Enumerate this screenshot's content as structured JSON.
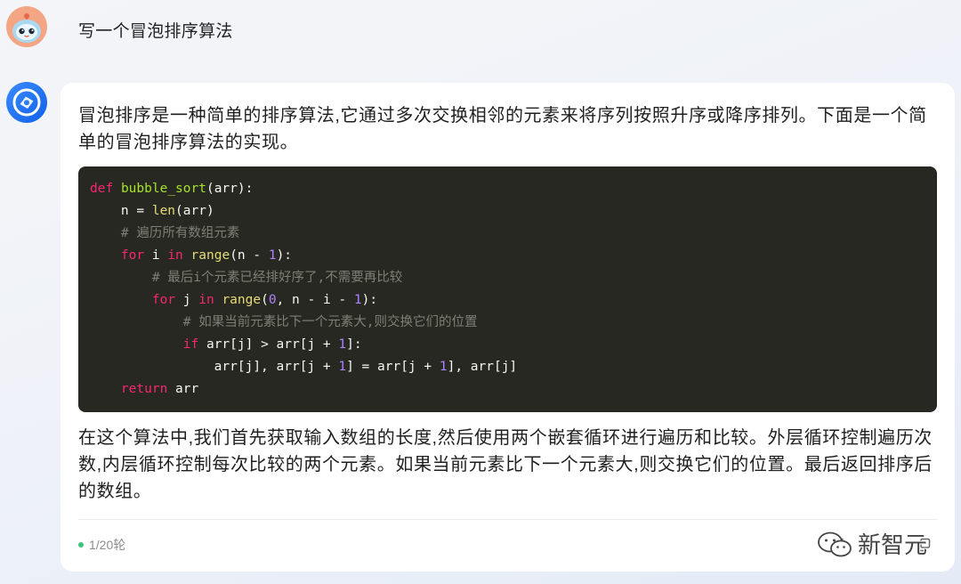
{
  "user": {
    "avatar_icon": "user-mascot-avatar",
    "message": "写一个冒泡排序算法"
  },
  "assistant": {
    "avatar_icon": "assistant-logo-avatar",
    "intro": "冒泡排序是一种简单的排序算法,它通过多次交换相邻的元素来将序列按照升序或降序排列。下面是一个简单的冒泡排序算法的实现。",
    "code": {
      "lines": [
        [
          {
            "type": "keyword",
            "text": "def"
          },
          {
            "type": "plain",
            "text": " "
          },
          {
            "type": "function",
            "text": "bubble_sort"
          },
          {
            "type": "plain",
            "text": "(arr):"
          }
        ],
        [
          {
            "type": "plain",
            "text": "    n = "
          },
          {
            "type": "builtin",
            "text": "len"
          },
          {
            "type": "plain",
            "text": "(arr)"
          }
        ],
        [
          {
            "type": "plain",
            "text": "    "
          },
          {
            "type": "comment",
            "text": "# 遍历所有数组元素"
          }
        ],
        [
          {
            "type": "plain",
            "text": "    "
          },
          {
            "type": "keyword",
            "text": "for"
          },
          {
            "type": "plain",
            "text": " i "
          },
          {
            "type": "keyword",
            "text": "in"
          },
          {
            "type": "plain",
            "text": " "
          },
          {
            "type": "builtin",
            "text": "range"
          },
          {
            "type": "plain",
            "text": "(n - "
          },
          {
            "type": "number",
            "text": "1"
          },
          {
            "type": "plain",
            "text": "):"
          }
        ],
        [
          {
            "type": "plain",
            "text": "        "
          },
          {
            "type": "comment",
            "text": "# 最后i个元素已经排好序了,不需要再比较"
          }
        ],
        [
          {
            "type": "plain",
            "text": "        "
          },
          {
            "type": "keyword",
            "text": "for"
          },
          {
            "type": "plain",
            "text": " j "
          },
          {
            "type": "keyword",
            "text": "in"
          },
          {
            "type": "plain",
            "text": " "
          },
          {
            "type": "builtin",
            "text": "range"
          },
          {
            "type": "plain",
            "text": "("
          },
          {
            "type": "number",
            "text": "0"
          },
          {
            "type": "plain",
            "text": ", n - i - "
          },
          {
            "type": "number",
            "text": "1"
          },
          {
            "type": "plain",
            "text": "):"
          }
        ],
        [
          {
            "type": "plain",
            "text": "            "
          },
          {
            "type": "comment",
            "text": "# 如果当前元素比下一个元素大,则交换它们的位置"
          }
        ],
        [
          {
            "type": "plain",
            "text": "            "
          },
          {
            "type": "keyword",
            "text": "if"
          },
          {
            "type": "plain",
            "text": " arr[j] > arr[j + "
          },
          {
            "type": "number",
            "text": "1"
          },
          {
            "type": "plain",
            "text": "]:"
          }
        ],
        [
          {
            "type": "plain",
            "text": "                arr[j], arr[j + "
          },
          {
            "type": "number",
            "text": "1"
          },
          {
            "type": "plain",
            "text": "] = arr[j + "
          },
          {
            "type": "number",
            "text": "1"
          },
          {
            "type": "plain",
            "text": "], arr[j]"
          }
        ],
        [
          {
            "type": "plain",
            "text": "    "
          },
          {
            "type": "keyword",
            "text": "return"
          },
          {
            "type": "plain",
            "text": " arr"
          }
        ]
      ]
    },
    "explanation": "在这个算法中,我们首先获取输入数组的长度,然后使用两个嵌套循环进行遍历和比较。外层循环控制遍历次数,内层循环控制每次比较的两个元素。如果当前元素比下一个元素大,则交换它们的位置。最后返回排序后的数组。",
    "footer": {
      "status_icon": "green-dot",
      "round_label": "1/20轮",
      "action_icons": [
        "refresh-icon",
        "copy-icon"
      ]
    }
  },
  "watermark": {
    "icon": "wechat-icon",
    "text": "新智元"
  },
  "colors": {
    "card_background": "#ffffff",
    "code_background": "#272822",
    "status_dot": "#3cc47c",
    "syntax": {
      "keyword": "#f92672",
      "function": "#a6e22e",
      "builtin": "#e6db74",
      "number": "#ae81ff",
      "comment": "#7f7f74",
      "plain": "#f8f8f2"
    }
  }
}
